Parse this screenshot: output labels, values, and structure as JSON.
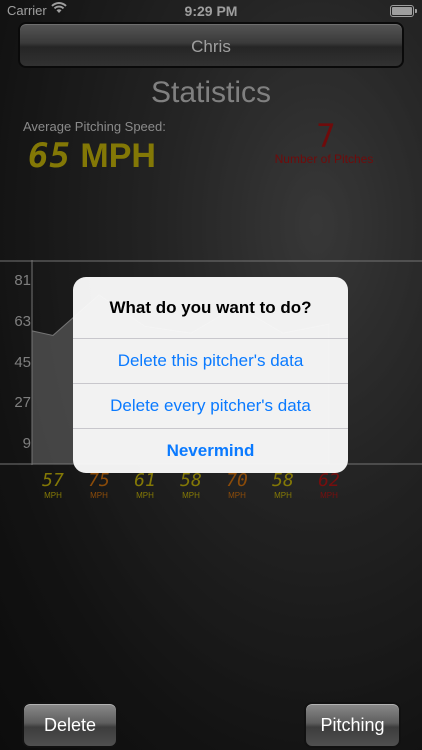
{
  "status_bar": {
    "carrier": "Carrier",
    "time": "9:29 PM"
  },
  "header": {
    "name": "Chris"
  },
  "stats": {
    "title": "Statistics",
    "avg_label": "Average Pitching Speed:",
    "avg_value": "65",
    "avg_unit": "MPH",
    "pitch_count": "7",
    "pitch_count_label": "Number of Pitches"
  },
  "chart_data": {
    "type": "area",
    "y_ticks": [
      "81",
      "63",
      "45",
      "27",
      "9"
    ],
    "ylim": [
      0,
      90
    ],
    "values": [
      57,
      75,
      61,
      58,
      70,
      58,
      62
    ],
    "unit_label": "MPH",
    "colors": [
      "#d4c20a",
      "#e07a10",
      "#d4c20a",
      "#d4c20a",
      "#e07a10",
      "#d4c20a",
      "#c01818"
    ]
  },
  "dialog": {
    "title": "What do you want to do?",
    "actions": [
      "Delete this pitcher's data",
      "Delete every pitcher's data",
      "Nevermind"
    ]
  },
  "footer": {
    "delete_label": "Delete",
    "pitching_label": "Pitching"
  },
  "colors": {
    "accent": "#0a7aff",
    "speed_yellow": "#d4c20a",
    "count_red": "#b31212"
  }
}
